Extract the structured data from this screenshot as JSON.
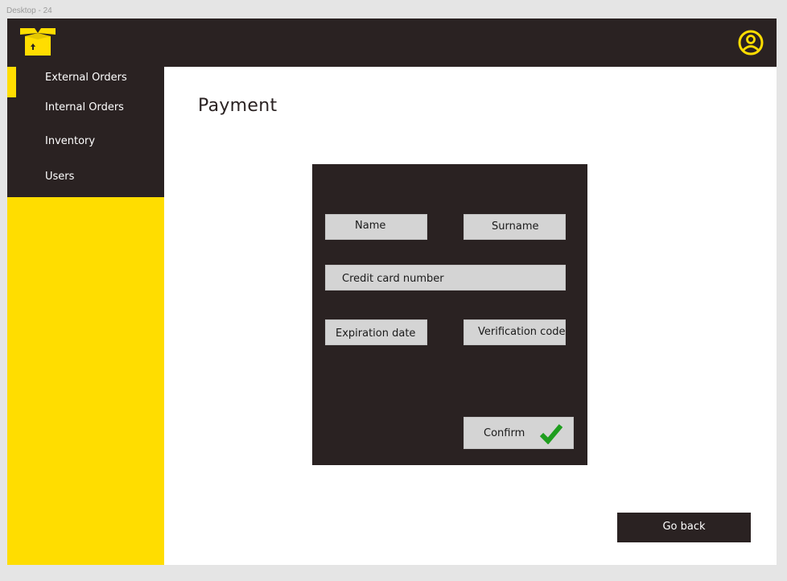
{
  "frame_label": "Desktop - 24",
  "header": {
    "logo_icon": "box-logo-icon",
    "profile_icon": "user-profile-icon",
    "accent": "#ffdd00",
    "background": "#2a2222"
  },
  "sidebar": {
    "items": [
      {
        "label": "External Orders",
        "active": true
      },
      {
        "label": "Internal Orders",
        "active": false
      },
      {
        "label": "Inventory",
        "active": false
      },
      {
        "label": "Users",
        "active": false
      }
    ]
  },
  "main": {
    "title": "Payment",
    "form": {
      "name": "Name",
      "surname": "Surname",
      "card_number": "Credit card number",
      "expiration": "Expiration date",
      "verification": "Verification code",
      "confirm_label": "Confirm",
      "confirm_icon": "checkmark-icon"
    },
    "go_back_label": "Go back"
  }
}
